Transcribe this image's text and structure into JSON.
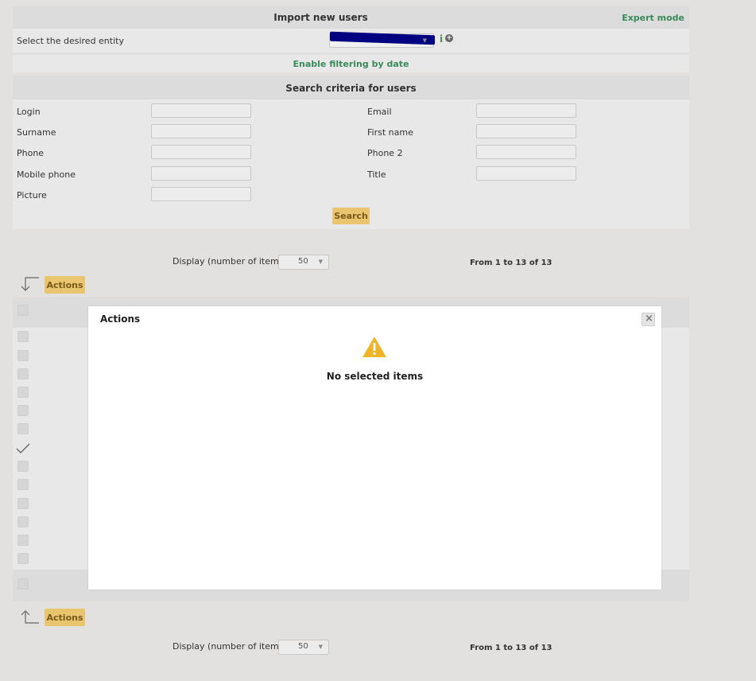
{
  "import": {
    "title": "Import new users",
    "expert_mode": "Expert mode",
    "entity_label": "Select the desired entity",
    "info_icon": "i",
    "filter_link": "Enable filtering by date"
  },
  "search": {
    "title": "Search criteria for users",
    "fields_left": [
      "Login",
      "Surname",
      "Phone",
      "Mobile phone",
      "Picture"
    ],
    "fields_right": [
      "Email",
      "First name",
      "Phone 2",
      "Title"
    ],
    "button": "Search"
  },
  "list": {
    "display_label": "Display (number of items)",
    "display_value": "50",
    "range": "From 1 to 13 of 13",
    "actions": "Actions"
  },
  "modal": {
    "title": "Actions",
    "close": "×",
    "message": "No selected items"
  },
  "colors": {
    "accent_green": "#3a8a5c",
    "button_yellow": "#e8c56e",
    "warning": "#f0b429"
  }
}
